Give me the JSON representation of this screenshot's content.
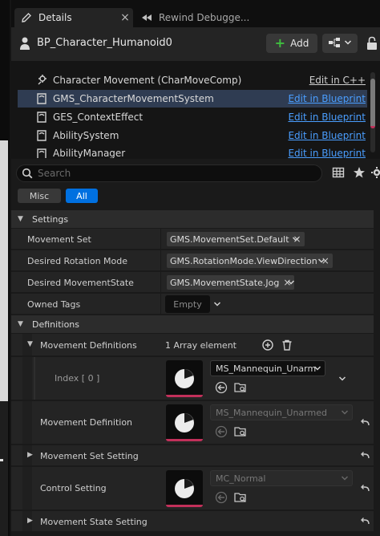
{
  "tabs": [
    {
      "label": "Details",
      "active": true,
      "close": "×"
    },
    {
      "label": "Rewind Debugge...",
      "active": false
    }
  ],
  "header": {
    "title": "BP_Character_Humanoid0",
    "add_label": "Add"
  },
  "components": [
    {
      "label": "Character Movement (CharMoveComp)",
      "link": "Edit in C++",
      "link_style": "plain",
      "icon": "gear-icon",
      "selected": false
    },
    {
      "label": "GMS_CharacterMovementSystem",
      "link": "Edit in Blueprint",
      "link_style": "link",
      "icon": "component-icon",
      "selected": true
    },
    {
      "label": "GES_ContextEffect",
      "link": "Edit in Blueprint",
      "link_style": "link",
      "icon": "component-icon",
      "selected": false
    },
    {
      "label": "AbilitySystem",
      "link": "Edit in Blueprint",
      "link_style": "link",
      "icon": "component-icon",
      "selected": false
    },
    {
      "label": "AbilityManager",
      "link": "Edit in Blueprint",
      "link_style": "link",
      "icon": "component-icon",
      "selected": false
    }
  ],
  "search": {
    "placeholder": "Search"
  },
  "filters": {
    "misc": "Misc",
    "all": "All"
  },
  "settings": {
    "label": "Settings",
    "rows": [
      {
        "name": "Movement Set",
        "value": "GMS.MovementSet.Default"
      },
      {
        "name": "Desired Rotation Mode",
        "value": "GMS.RotationMode.ViewDirection"
      },
      {
        "name": "Desired MovementState",
        "value": "GMS.MovementState.Jog"
      },
      {
        "name": "Owned Tags",
        "value": "Empty"
      }
    ],
    "x": "×"
  },
  "definitions": {
    "label": "Definitions",
    "movement_definitions": {
      "name": "Movement Definitions",
      "summary": "1 Array element"
    },
    "index": {
      "name": "Index [ 0 ]",
      "asset": "MS_Mannequin_Unarm"
    },
    "movement_definition": {
      "name": "Movement Definition",
      "asset": "MS_Mannequin_Unarmed"
    },
    "movement_set_setting": {
      "name": "Movement Set Setting"
    },
    "control_setting": {
      "name": "Control Setting",
      "asset": "MC_Normal"
    },
    "movement_state_setting": {
      "name": "Movement State Setting"
    }
  },
  "colors": {
    "accent_blue": "#0070e0",
    "link_blue": "#4a9eff",
    "selection": "#2f3c52",
    "asset_underline": "#c2305a",
    "add_plus": "#3fbf3f"
  }
}
